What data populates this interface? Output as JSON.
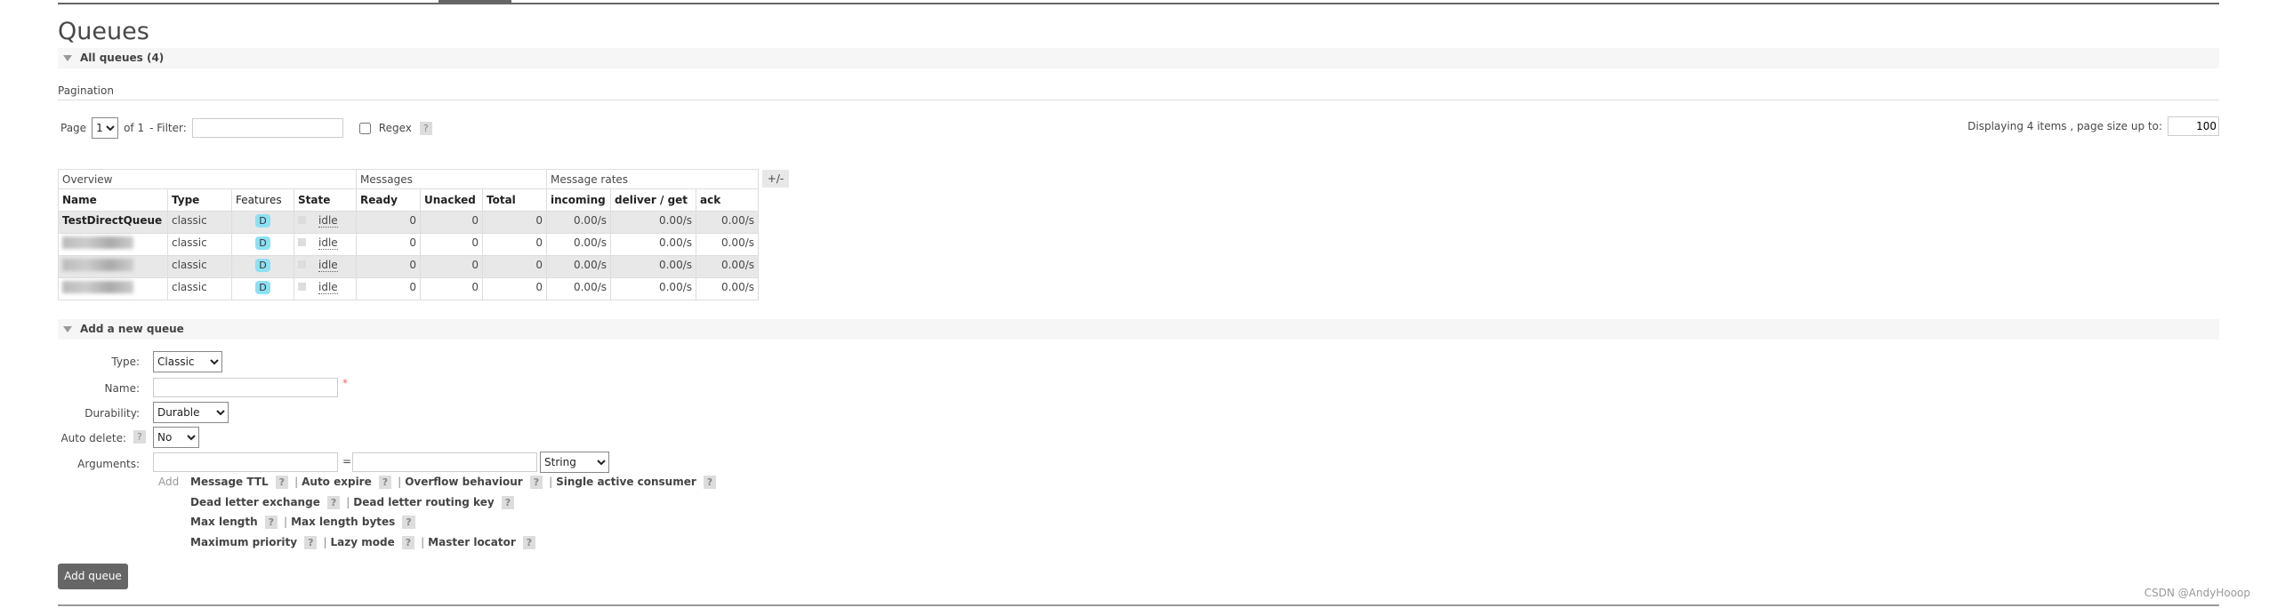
{
  "title": "Queues",
  "all_queues": "All queues (4)",
  "pagination": {
    "label": "Pagination",
    "page_label": "Page",
    "page_value": "1",
    "of": "of 1",
    "filter_label": "- Filter:",
    "regex": "Regex",
    "help": "?",
    "display": "Displaying 4 items , page size up to:",
    "page_size": "100"
  },
  "table": {
    "groups": [
      "Overview",
      "Messages",
      "Message rates"
    ],
    "columns": [
      "Name",
      "Type",
      "Features",
      "State",
      "Ready",
      "Unacked",
      "Total",
      "incoming",
      "deliver / get",
      "ack"
    ],
    "toggle": "+/-",
    "rows": [
      {
        "name": "TestDirectQueue",
        "type": "classic",
        "features": "D",
        "state": "idle",
        "ready": "0",
        "unacked": "0",
        "total": "0",
        "incoming": "0.00/s",
        "deliver": "0.00/s",
        "ack": "0.00/s"
      },
      {
        "name": "",
        "type": "classic",
        "features": "D",
        "state": "idle",
        "ready": "0",
        "unacked": "0",
        "total": "0",
        "incoming": "0.00/s",
        "deliver": "0.00/s",
        "ack": "0.00/s"
      },
      {
        "name": "",
        "type": "classic",
        "features": "D",
        "state": "idle",
        "ready": "0",
        "unacked": "0",
        "total": "0",
        "incoming": "0.00/s",
        "deliver": "0.00/s",
        "ack": "0.00/s"
      },
      {
        "name": "",
        "type": "classic",
        "features": "D",
        "state": "idle",
        "ready": "0",
        "unacked": "0",
        "total": "0",
        "incoming": "0.00/s",
        "deliver": "0.00/s",
        "ack": "0.00/s"
      }
    ]
  },
  "add_queue": {
    "heading": "Add a new queue",
    "type_label": "Type:",
    "type_value": "Classic",
    "name_label": "Name:",
    "required": "*",
    "durability_label": "Durability:",
    "durability_value": "Durable",
    "auto_delete_label": "Auto delete:",
    "auto_delete_value": "No",
    "arguments_label": "Arguments:",
    "equals": "=",
    "arg_type": "String",
    "add": "Add",
    "arg_links": [
      [
        "Message TTL",
        "Auto expire",
        "Overflow behaviour",
        "Single active consumer"
      ],
      [
        "Dead letter exchange",
        "Dead letter routing key"
      ],
      [
        "Max length",
        "Max length bytes"
      ],
      [
        "Maximum priority",
        "Lazy mode",
        "Master locator"
      ]
    ],
    "submit": "Add queue"
  },
  "watermark": "CSDN @AndyHooop"
}
